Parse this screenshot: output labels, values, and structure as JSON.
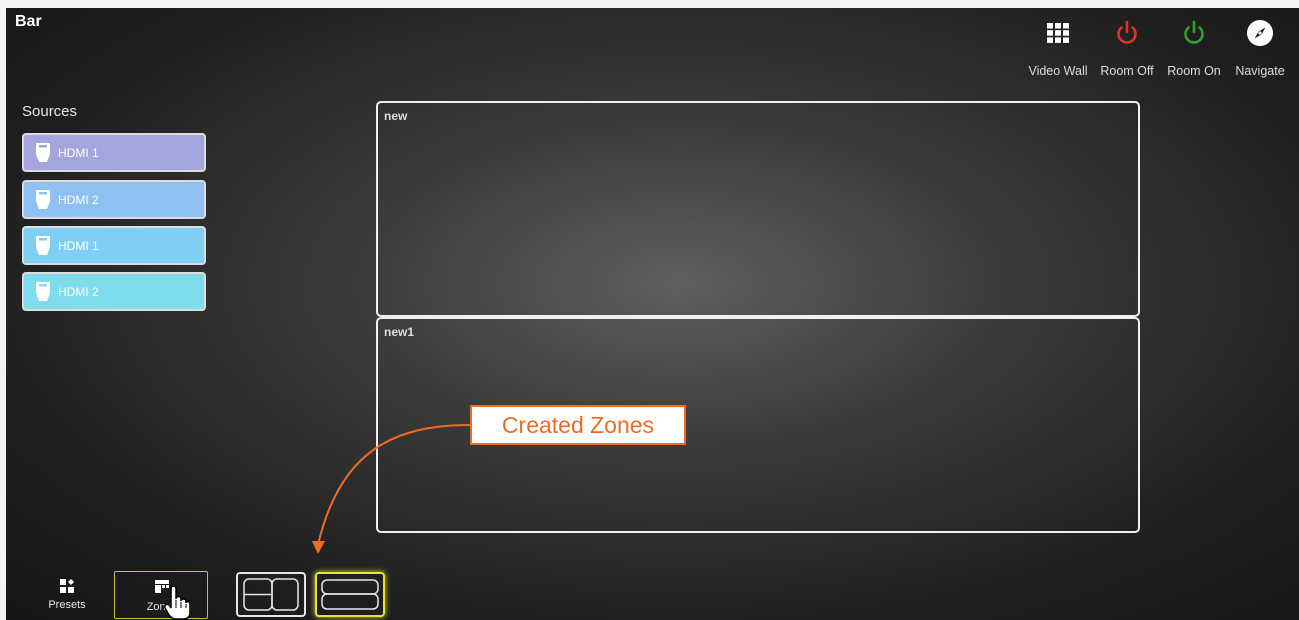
{
  "room": {
    "title": "Bar"
  },
  "top_buttons": [
    {
      "label": "Video Wall",
      "icon": "grid-icon",
      "color": "#ffffff"
    },
    {
      "label": "Room Off",
      "icon": "power-icon",
      "color": "#e0302b"
    },
    {
      "label": "Room On",
      "icon": "power-icon",
      "color": "#2ea12e"
    },
    {
      "label": "Navigate",
      "icon": "compass-icon",
      "color": "#ffffff"
    }
  ],
  "sources": {
    "title": "Sources",
    "items": [
      {
        "label": "HDMI 1",
        "color": "#a3a6dd"
      },
      {
        "label": "HDMI 2",
        "color": "#8ec0f1"
      },
      {
        "label": "HDMI 1",
        "color": "#7fcff4"
      },
      {
        "label": "HDMI 2",
        "color": "#7fdcec"
      }
    ]
  },
  "zones": [
    {
      "name": "new"
    },
    {
      "name": "new1"
    }
  ],
  "callout": {
    "text": "Created Zones",
    "color": "#ef6b22"
  },
  "bottom": {
    "presets_label": "Presets",
    "zones_label": "Zones",
    "selected_highlight": "#e6e23a"
  }
}
